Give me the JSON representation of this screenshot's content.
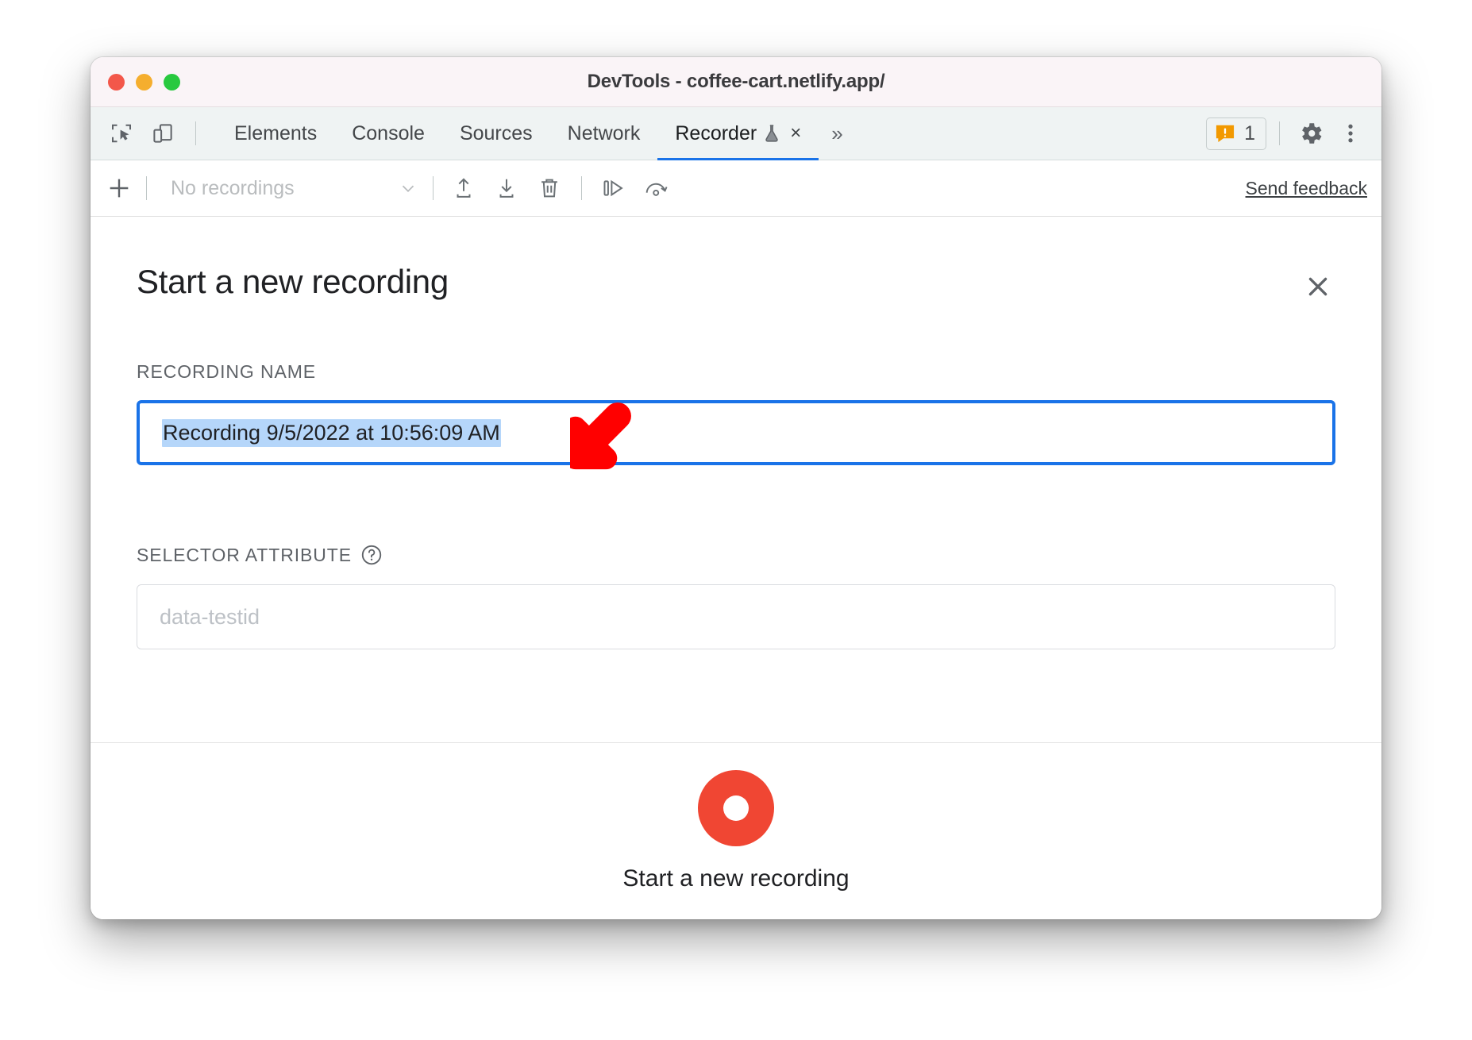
{
  "window": {
    "title": "DevTools - coffee-cart.netlify.app/",
    "traffic_lights": [
      "close-red",
      "minimize-yellow",
      "maximize-green"
    ],
    "accent_blue": "#1a73e8",
    "record_red": "#f04633",
    "titlebar_bg": "#faf4f7",
    "tabbar_bg": "#eff3f3"
  },
  "tabbar": {
    "left_icons": [
      {
        "name": "inspect-element-icon",
        "label": "Inspect element"
      },
      {
        "name": "device-toolbar-icon",
        "label": "Toggle device toolbar"
      }
    ],
    "tabs": [
      {
        "label": "Elements",
        "active": false
      },
      {
        "label": "Console",
        "active": false
      },
      {
        "label": "Sources",
        "active": false
      },
      {
        "label": "Network",
        "active": false
      },
      {
        "label": "Recorder",
        "active": true,
        "experimental": true,
        "closeable": true
      }
    ],
    "tab_close_glyph": "×",
    "more_tabs_glyph": "»",
    "warnings": {
      "count": "1",
      "icon": "warning-icon",
      "color": "#f29900"
    },
    "settings_label": "Settings",
    "more_options_label": "Customize and control DevTools"
  },
  "recorder_toolbar": {
    "add_label": "+",
    "recordings_select_value": "No recordings",
    "recordings_select_options": [
      "No recordings"
    ],
    "actions": [
      {
        "name": "import-recording-icon",
        "label": "Import recording"
      },
      {
        "name": "export-recording-icon",
        "label": "Export recording"
      },
      {
        "name": "delete-recording-icon",
        "label": "Delete recording"
      },
      {
        "name": "step-over-icon",
        "label": "Step over"
      },
      {
        "name": "replay-speed-icon",
        "label": "Replay settings"
      }
    ],
    "feedback_link": "Send feedback"
  },
  "panel": {
    "title": "Start a new recording",
    "close_glyph": "✕",
    "recording_name": {
      "label": "RECORDING NAME",
      "value": "Recording 9/5/2022 at 10:56:09 AM",
      "selected": true,
      "focused": true
    },
    "selector_attribute": {
      "label": "SELECTOR ATTRIBUTE",
      "help_glyph": "?",
      "value": "",
      "placeholder": "data-testid"
    },
    "start_button": {
      "label": "Start a new recording",
      "icon": "record-dot-icon"
    }
  },
  "annotation": {
    "arrow": {
      "name": "callout-arrow",
      "direction": "down-left",
      "color": "#ff0000"
    }
  }
}
